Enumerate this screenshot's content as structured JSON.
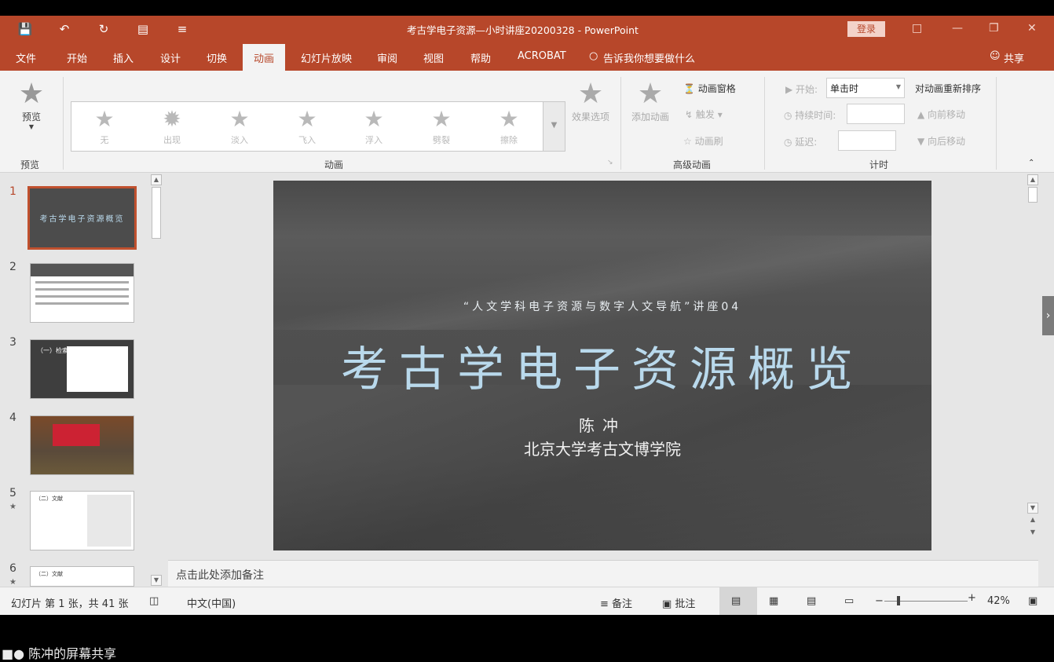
{
  "window": {
    "doc_title": "考古学电子资源—小时讲座20200328  -  PowerPoint",
    "login_label": "登录",
    "qat_icons": [
      "save-icon",
      "undo-icon",
      "redo-icon",
      "present-icon",
      "customize-icon"
    ]
  },
  "tabs": [
    {
      "label": "文件"
    },
    {
      "label": "开始"
    },
    {
      "label": "插入"
    },
    {
      "label": "设计"
    },
    {
      "label": "切换"
    },
    {
      "label": "动画"
    },
    {
      "label": "幻灯片放映"
    },
    {
      "label": "审阅"
    },
    {
      "label": "视图"
    },
    {
      "label": "帮助"
    },
    {
      "label": "ACROBAT"
    }
  ],
  "active_tab": "动画",
  "tell_me": "告诉我你想要做什么",
  "share_label": "共享",
  "ribbon": {
    "preview": {
      "button": "预览",
      "group": "预览"
    },
    "animation": {
      "group": "动画",
      "gallery": [
        {
          "label": "无"
        },
        {
          "label": "出现"
        },
        {
          "label": "淡入"
        },
        {
          "label": "飞入"
        },
        {
          "label": "浮入"
        },
        {
          "label": "劈裂"
        },
        {
          "label": "擦除"
        }
      ],
      "effect_options": "效果选项"
    },
    "advanced": {
      "group": "高级动画",
      "add_animation": "添加动画",
      "pane": "动画窗格",
      "trigger": "触发",
      "painter": "动画刷"
    },
    "timing": {
      "group": "计时",
      "start_label": "开始:",
      "start_value": "单击时",
      "duration_label": "持续时间:",
      "delay_label": "延迟:",
      "reorder": "对动画重新排序",
      "move_earlier": "向前移动",
      "move_later": "向后移动"
    }
  },
  "thumbnails": [
    {
      "num": "1",
      "title": "考古学电子资源概览"
    },
    {
      "num": "2"
    },
    {
      "num": "3",
      "title": "（一）检索"
    },
    {
      "num": "4"
    },
    {
      "num": "5",
      "star": "★",
      "title": "（二）文献"
    },
    {
      "num": "6",
      "star": "★",
      "title": "（二）文献"
    }
  ],
  "slide": {
    "subtitle": "“人文学科电子资源与数字人文导航”讲座04",
    "title": "考古学电子资源概览",
    "author": "陈冲",
    "org": "北京大学考古文博学院"
  },
  "notes_placeholder": "点击此处添加备注",
  "status": {
    "slide_info": "幻灯片 第 1 张，共 41 张",
    "language": "中文(中国)",
    "notes": "备注",
    "comments": "批注",
    "zoom": "42%"
  },
  "share_bar": "陈冲的屏幕共享"
}
